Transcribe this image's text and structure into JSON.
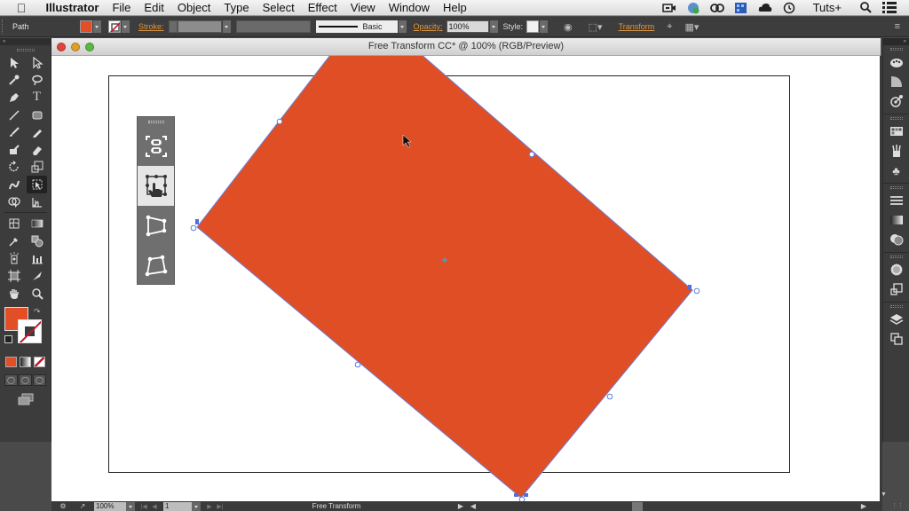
{
  "menubar": {
    "apple_icon": "apple-logo-icon",
    "app_name": "Illustrator",
    "items": [
      "File",
      "Edit",
      "Object",
      "Type",
      "Select",
      "Effect",
      "View",
      "Window",
      "Help"
    ],
    "tray": [
      "video-camera-icon",
      "sync-globe-icon",
      "creative-cloud-icon",
      "grid-app-icon",
      "cloud-icon",
      "time-machine-icon"
    ],
    "tuts_label": "Tuts+",
    "search_icon": "spotlight-search-icon",
    "list_icon": "notification-list-icon"
  },
  "control_bar": {
    "selection_type": "Path",
    "fill_color": "#e24e26",
    "stroke_label": "Stroke:",
    "stroke_profile_label": "Basic",
    "opacity_label": "Opacity:",
    "opacity_value": "100%",
    "style_label": "Style:",
    "transform_label": "Transform"
  },
  "document": {
    "title": "Free Transform CC* @ 100% (RGB/Preview)",
    "shape_color": "#e04e26",
    "selection_color": "#5a7ee8"
  },
  "free_transform_widget": {
    "tools": [
      {
        "name": "constrain-icon",
        "selected": false
      },
      {
        "name": "free-transform-icon",
        "selected": true
      },
      {
        "name": "perspective-distort-icon",
        "selected": false
      },
      {
        "name": "free-distort-icon",
        "selected": false
      }
    ]
  },
  "toolbar": {
    "collapse_label": "«",
    "fill_color": "#e24e26",
    "tools": [
      "selection-tool",
      "direct-selection-tool",
      "magic-wand-tool",
      "lasso-tool",
      "pen-tool",
      "type-tool",
      "line-segment-tool",
      "rectangle-tool",
      "paintbrush-tool",
      "pencil-tool",
      "blob-brush-tool",
      "eraser-tool",
      "rotate-tool",
      "scale-tool",
      "warp-tool",
      "free-transform-tool",
      "shape-builder-tool",
      "perspective-grid-tool",
      "mesh-tool",
      "gradient-tool",
      "eyedropper-tool",
      "blend-tool",
      "symbol-sprayer-tool",
      "column-graph-tool",
      "artboard-tool",
      "slice-tool",
      "hand-tool",
      "zoom-tool"
    ]
  },
  "panel_dock": {
    "collapse_label": "»",
    "groups": [
      [
        "color-panel-icon",
        "color-guide-icon",
        "recolor-icon"
      ],
      [
        "swatches-icon",
        "brushes-icon",
        "symbols-icon"
      ],
      [
        "stroke-icon",
        "gradient-icon",
        "transparency-icon"
      ],
      [
        "appearance-icon",
        "graphic-styles-icon"
      ],
      [
        "layers-icon",
        "artboards-icon"
      ]
    ]
  },
  "status_bar": {
    "zoom_value": "100%",
    "artboard_number": "1",
    "current_tool": "Free Transform"
  }
}
